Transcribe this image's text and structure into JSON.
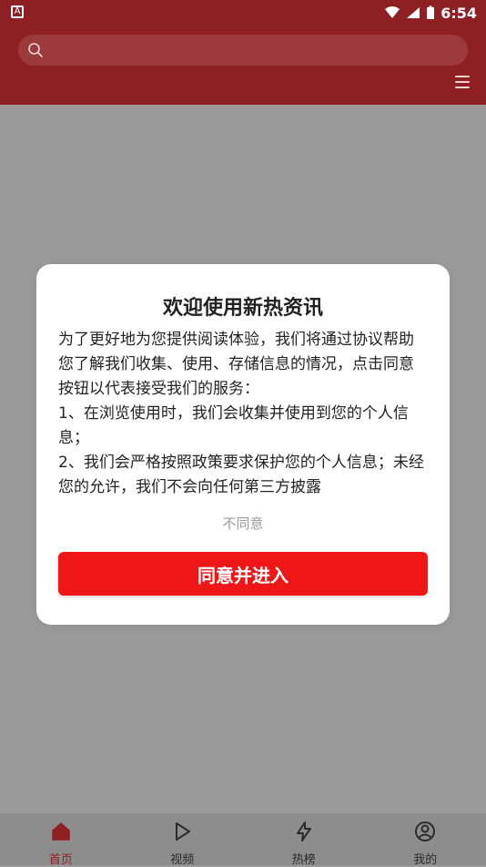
{
  "status_bar": {
    "time": "6:54"
  },
  "search": {
    "placeholder": ""
  },
  "modal": {
    "title": "欢迎使用新热资讯",
    "paragraphs": [
      "为了更好地为您提供阅读体验，我们将通过协议帮助您了解我们收集、使用、存储信息的情况，点击同意按钮以代表接受我们的服务：",
      "1、在浏览使用时，我们会收集并使用到您的个人信息；",
      "2、我们会严格按照政策要求保护您的个人信息；未经您的允许，我们不会向任何第三方披露"
    ],
    "decline_label": "不同意",
    "agree_label": "同意并进入"
  },
  "bottom_nav": {
    "items": [
      {
        "label": "首页",
        "icon": "home-icon",
        "active": true
      },
      {
        "label": "视频",
        "icon": "play-icon",
        "active": false
      },
      {
        "label": "热榜",
        "icon": "lightning-icon",
        "active": false
      },
      {
        "label": "我的",
        "icon": "user-circle-icon",
        "active": false
      }
    ]
  },
  "colors": {
    "header_bg": "#8e1f22",
    "accent": "#ee1616",
    "overlay_bg": "#9a9a9a"
  }
}
